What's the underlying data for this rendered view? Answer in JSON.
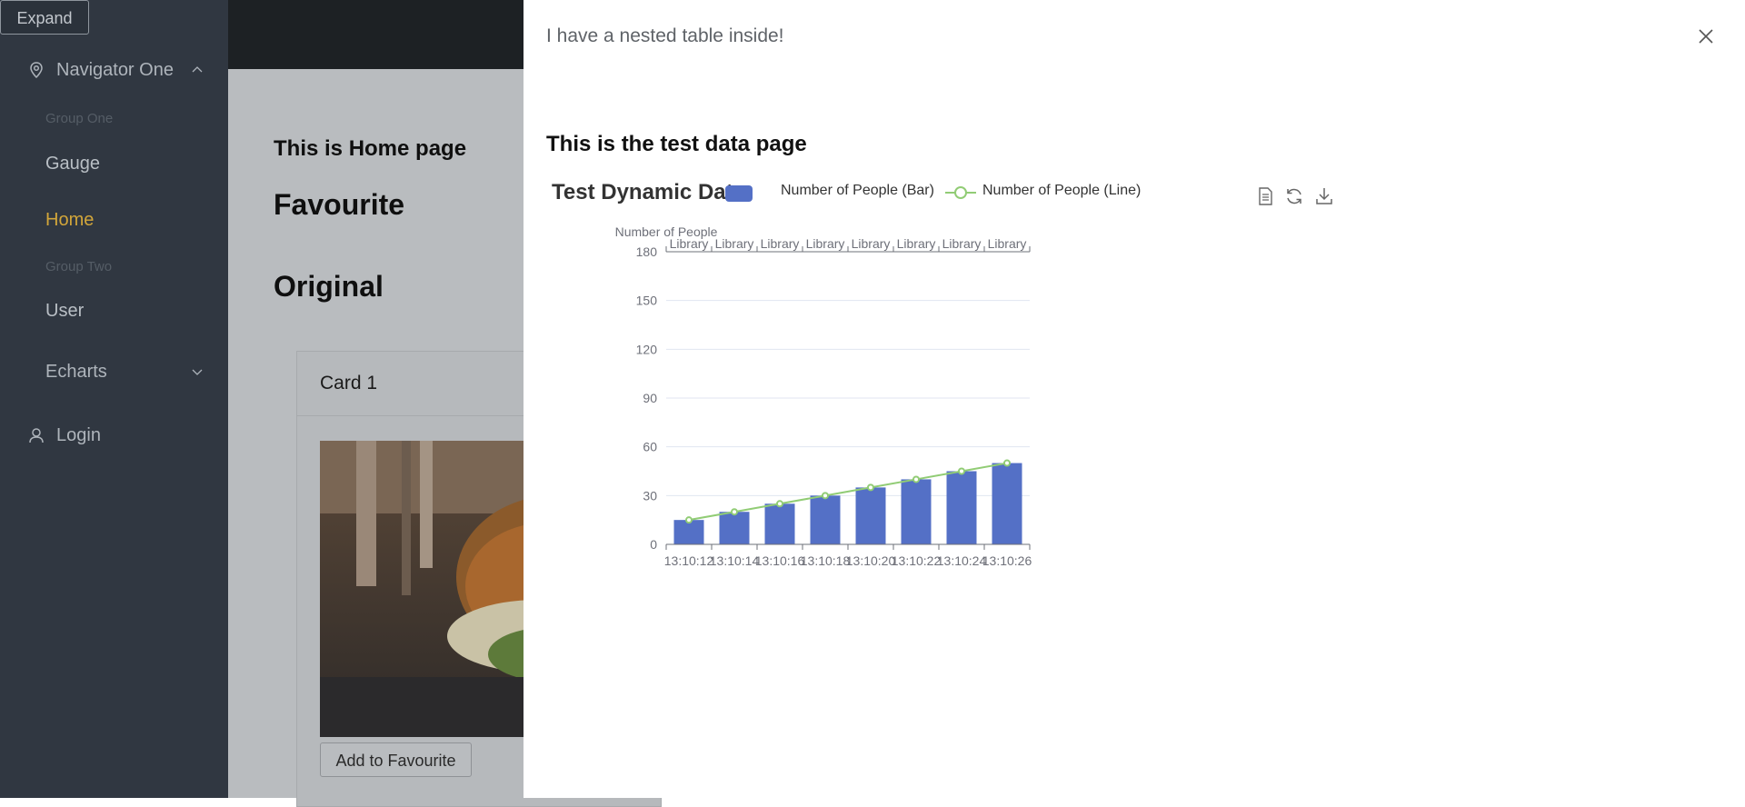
{
  "sidebar": {
    "expand_label": "Expand",
    "navigator_label": "Navigator One",
    "group_one": "Group One",
    "gauge": "Gauge",
    "home": "Home",
    "group_two": "Group Two",
    "user": "User",
    "echarts": "Echarts",
    "login": "Login"
  },
  "page": {
    "title": "This is Home page",
    "favourite": "Favourite",
    "original": "Original",
    "card_title": "Card 1",
    "add_favourite": "Add to Favourite"
  },
  "drawer": {
    "title": "I have a nested table inside!",
    "data_title": "This is the test data page"
  },
  "colors": {
    "bar": "#5470c6",
    "line": "#91cc75",
    "active_nav": "#d2a63a"
  },
  "chart_data": {
    "type": "bar",
    "title": "Test Dynamic Data",
    "ylabel": "Number of People",
    "ylim": [
      0,
      180
    ],
    "yticks": [
      0,
      30,
      60,
      90,
      120,
      150,
      180
    ],
    "categories": [
      "13:10:12",
      "13:10:14",
      "13:10:16",
      "13:10:18",
      "13:10:20",
      "13:10:22",
      "13:10:24",
      "13:10:26"
    ],
    "top_categories": [
      "Library",
      "Library",
      "Library",
      "Library",
      "Library",
      "Library",
      "Library",
      "Library"
    ],
    "series": [
      {
        "name": "Number of People (Bar)",
        "type": "bar",
        "values": [
          15,
          20,
          25,
          30,
          35,
          40,
          45,
          50
        ]
      },
      {
        "name": "Number of People (Line)",
        "type": "line",
        "values": [
          15,
          20,
          25,
          30,
          35,
          40,
          45,
          50
        ]
      }
    ],
    "legend_position": "top",
    "grid": true
  }
}
